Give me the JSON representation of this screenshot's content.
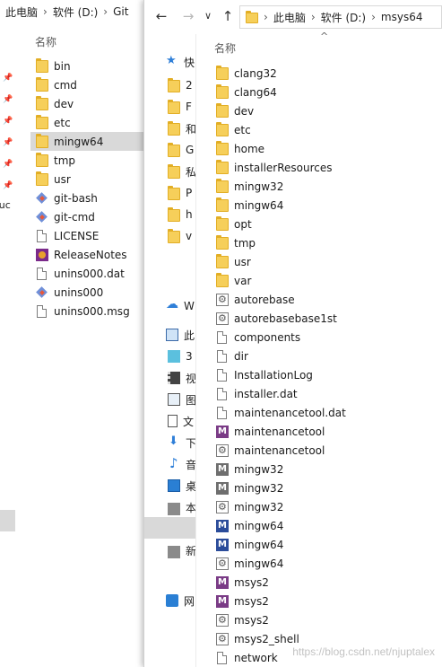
{
  "back_window": {
    "breadcrumb": [
      "此电脑",
      "软件 (D:)",
      "Git"
    ],
    "column_header": "名称",
    "nav_fragment": "ouc",
    "items": [
      {
        "name": "bin",
        "icon": "folder-icon"
      },
      {
        "name": "cmd",
        "icon": "folder-icon"
      },
      {
        "name": "dev",
        "icon": "folder-icon"
      },
      {
        "name": "etc",
        "icon": "folder-icon"
      },
      {
        "name": "mingw64",
        "icon": "folder-icon",
        "selected": true
      },
      {
        "name": "tmp",
        "icon": "folder-icon"
      },
      {
        "name": "usr",
        "icon": "folder-icon"
      },
      {
        "name": "git-bash",
        "icon": "git-icon"
      },
      {
        "name": "git-cmd",
        "icon": "git-icon"
      },
      {
        "name": "LICENSE",
        "icon": "file-icon"
      },
      {
        "name": "ReleaseNotes",
        "icon": "release-notes-icon"
      },
      {
        "name": "unins000.dat",
        "icon": "file-icon"
      },
      {
        "name": "unins000",
        "icon": "git-icon"
      },
      {
        "name": "unins000.msg",
        "icon": "file-icon"
      }
    ]
  },
  "front_window": {
    "breadcrumb": [
      "此电脑",
      "软件 (D:)",
      "msys64"
    ],
    "column_header": "名称",
    "nav": {
      "quick_access": "快",
      "onedrive": "W",
      "this_pc": "此",
      "network": "网",
      "quick_items": [
        "2",
        "F",
        "和",
        "G",
        "私",
        "P",
        "h",
        "v"
      ],
      "pc_items": [
        "3",
        "视",
        "图",
        "文",
        "下",
        "音",
        "桌",
        "本",
        "本",
        "新"
      ]
    },
    "items": [
      {
        "name": "clang32",
        "icon": "folder-icon"
      },
      {
        "name": "clang64",
        "icon": "folder-icon"
      },
      {
        "name": "dev",
        "icon": "folder-icon"
      },
      {
        "name": "etc",
        "icon": "folder-icon"
      },
      {
        "name": "home",
        "icon": "folder-icon"
      },
      {
        "name": "installerResources",
        "icon": "folder-icon"
      },
      {
        "name": "mingw32",
        "icon": "folder-icon"
      },
      {
        "name": "mingw64",
        "icon": "folder-icon"
      },
      {
        "name": "opt",
        "icon": "folder-icon"
      },
      {
        "name": "tmp",
        "icon": "folder-icon"
      },
      {
        "name": "usr",
        "icon": "folder-icon"
      },
      {
        "name": "var",
        "icon": "folder-icon"
      },
      {
        "name": "autorebase",
        "icon": "gear-file-icon"
      },
      {
        "name": "autorebasebase1st",
        "icon": "gear-file-icon"
      },
      {
        "name": "components",
        "icon": "file-icon"
      },
      {
        "name": "dir",
        "icon": "file-icon"
      },
      {
        "name": "InstallationLog",
        "icon": "file-icon"
      },
      {
        "name": "installer.dat",
        "icon": "file-icon"
      },
      {
        "name": "maintenancetool.dat",
        "icon": "file-icon"
      },
      {
        "name": "maintenancetool",
        "icon": "msys-icon"
      },
      {
        "name": "maintenancetool",
        "icon": "gear-file-icon"
      },
      {
        "name": "mingw32",
        "icon": "msys-gray-icon"
      },
      {
        "name": "mingw32",
        "icon": "msys-gray-icon"
      },
      {
        "name": "mingw32",
        "icon": "gear-file-icon"
      },
      {
        "name": "mingw64",
        "icon": "msys-blue-icon"
      },
      {
        "name": "mingw64",
        "icon": "msys-blue-icon"
      },
      {
        "name": "mingw64",
        "icon": "gear-file-icon"
      },
      {
        "name": "msys2",
        "icon": "msys-icon"
      },
      {
        "name": "msys2",
        "icon": "msys-icon"
      },
      {
        "name": "msys2",
        "icon": "gear-file-icon"
      },
      {
        "name": "msys2_shell",
        "icon": "gear-file-icon"
      },
      {
        "name": "network",
        "icon": "file-icon"
      }
    ]
  },
  "watermark": "https://blog.csdn.net/njuptalex",
  "colors": {
    "folder": "#f6cf5a",
    "selection": "#d9d9d9",
    "accent": "#2f7fd8",
    "msys_purple": "#7a3b86",
    "msys_blue": "#2b4c9a"
  }
}
